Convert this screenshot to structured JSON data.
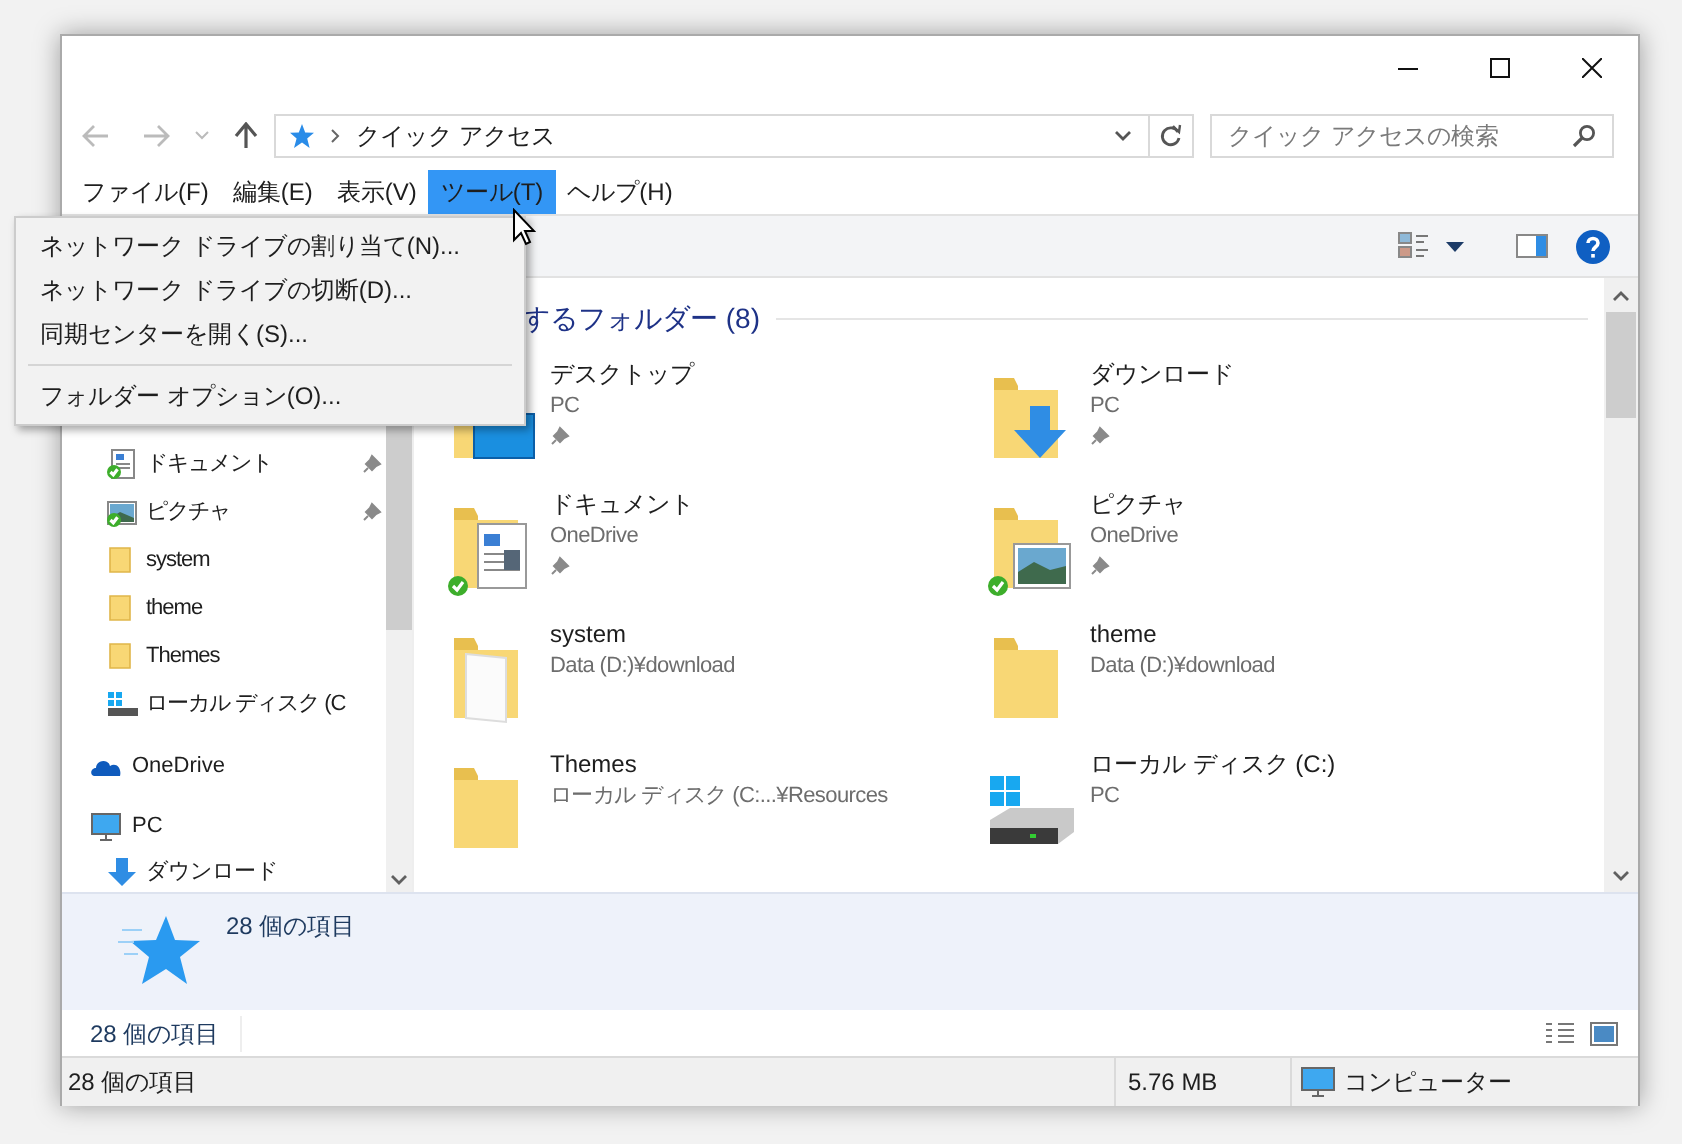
{
  "navigation": {
    "address": "クイック アクセス",
    "search": {
      "placeholder": "クイック アクセスの検索"
    }
  },
  "menu_bar": [
    {
      "label": "ファイル(F)",
      "selected": false
    },
    {
      "label": "編集(E)",
      "selected": false
    },
    {
      "label": "表示(V)",
      "selected": false
    },
    {
      "label": "ツール(T)",
      "selected": true
    },
    {
      "label": "ヘルプ(H)",
      "selected": false
    }
  ],
  "dropdown_menu": [
    {
      "kind": "item",
      "label": "ネットワーク ドライブの割り当て(N)..."
    },
    {
      "kind": "item",
      "label": "ネットワーク ドライブの切断(D)..."
    },
    {
      "kind": "item",
      "label": "同期センターを開く(S)..."
    },
    {
      "kind": "separator"
    },
    {
      "kind": "item",
      "label": "フォルダー オプション(O)..."
    }
  ],
  "sidebar": {
    "quick_access_items": [
      {
        "label": "ドキュメント",
        "kind": "document",
        "pinned": true,
        "synced": true
      },
      {
        "label": "ピクチャ",
        "kind": "picture",
        "pinned": true,
        "synced": true
      },
      {
        "label": "system",
        "kind": "folder",
        "pinned": false,
        "synced": false
      },
      {
        "label": "theme",
        "kind": "folder",
        "pinned": false,
        "synced": false
      },
      {
        "label": "Themes",
        "kind": "folder",
        "pinned": false,
        "synced": false
      },
      {
        "label": "ローカル ディスク (C",
        "kind": "drive",
        "pinned": false,
        "synced": false
      }
    ],
    "items": [
      {
        "label": "OneDrive",
        "kind": "onedrive"
      },
      {
        "label": "PC",
        "kind": "pc",
        "children": [
          {
            "label": "ダウンロード",
            "kind": "download"
          }
        ]
      }
    ]
  },
  "content": {
    "group_header": "するフォルダー (8)",
    "folders": [
      {
        "name": "デスクトップ",
        "location": "PC",
        "kind": "desktop",
        "pinned": true,
        "synced": false
      },
      {
        "name": "ダウンロード",
        "location": "PC",
        "kind": "download",
        "pinned": true,
        "synced": false
      },
      {
        "name": "ドキュメント",
        "location": "OneDrive",
        "kind": "document",
        "pinned": true,
        "synced": true
      },
      {
        "name": "ピクチャ",
        "location": "OneDrive",
        "kind": "picture",
        "pinned": true,
        "synced": true
      },
      {
        "name": "system",
        "location": "Data (D:)¥download",
        "kind": "open-folder",
        "pinned": false,
        "synced": false
      },
      {
        "name": "theme",
        "location": "Data (D:)¥download",
        "kind": "folder",
        "pinned": false,
        "synced": false
      },
      {
        "name": "Themes",
        "location": "ローカル ディスク (C:...¥Resources",
        "kind": "folder",
        "pinned": false,
        "synced": false
      },
      {
        "name": "ローカル ディスク (C:)",
        "location": "PC",
        "kind": "drive",
        "pinned": false,
        "synced": false
      }
    ]
  },
  "details_pane": {
    "count": "28 個の項目"
  },
  "inner_status": {
    "count": "28 個の項目"
  },
  "status_bar": {
    "items": "28 個の項目",
    "size": "5.76 MB",
    "location": "コンピューター"
  }
}
